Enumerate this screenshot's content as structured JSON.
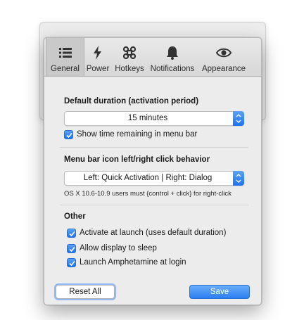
{
  "toolbar": {
    "tabs": [
      {
        "label": "General",
        "icon": "list-icon",
        "selected": true
      },
      {
        "label": "Power",
        "icon": "bolt-icon",
        "selected": false
      },
      {
        "label": "Hotkeys",
        "icon": "command-key-icon",
        "selected": false
      },
      {
        "label": "Notifications",
        "icon": "bell-icon",
        "selected": false
      },
      {
        "label": "Appearance",
        "icon": "eye-icon",
        "selected": false
      }
    ]
  },
  "default_duration": {
    "title": "Default duration (activation period)",
    "selected": "15 minutes",
    "show_time_label": "Show time remaining in menu bar",
    "show_time_checked": true
  },
  "menu_bar_behavior": {
    "title": "Menu bar icon left/right click behavior",
    "selected": "Left: Quick Activation | Right: Dialog",
    "note": "OS X 10.6-10.9 users must {control + click} for right-click"
  },
  "other": {
    "title": "Other",
    "options": [
      {
        "label": "Activate at launch (uses default duration)",
        "checked": true
      },
      {
        "label": "Allow display to sleep",
        "checked": true
      },
      {
        "label": "Launch Amphetamine at login",
        "checked": true
      }
    ]
  },
  "buttons": {
    "reset": "Reset All",
    "save": "Save"
  },
  "colors": {
    "accent": "#1e73ef",
    "selected_tab": "#c9c9c9"
  }
}
